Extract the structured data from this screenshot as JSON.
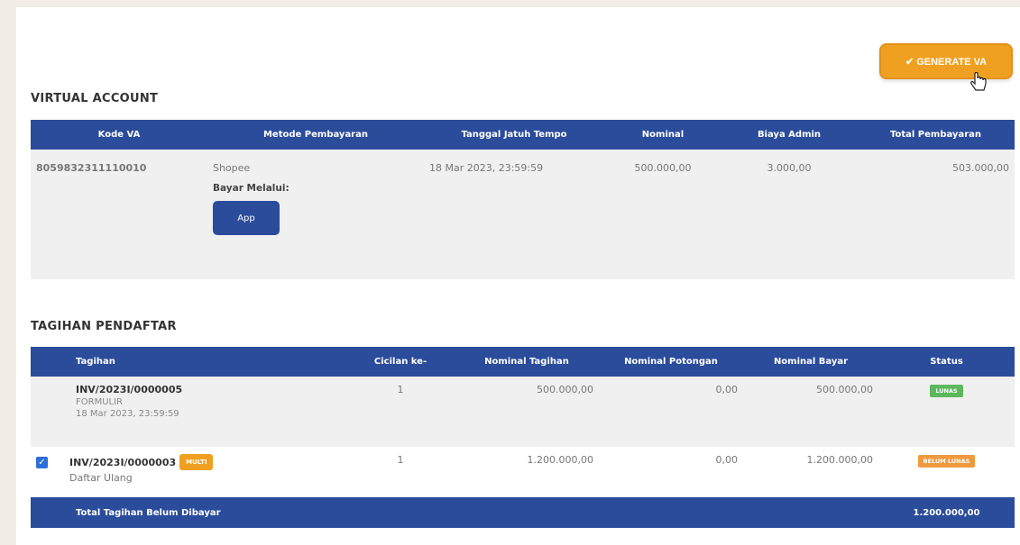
{
  "actions": {
    "generate_va_label": "✔ GENERATE VA"
  },
  "virtual_account": {
    "title": "VIRTUAL ACCOUNT",
    "columns": [
      "Kode VA",
      "Metode Pembayaran",
      "Tanggal Jatuh Tempo",
      "Nominal",
      "Biaya Admin",
      "Total Pembayaran"
    ],
    "row": {
      "kode_va": "8059832311110010",
      "metode": "Shopee",
      "bayar_melalui_label": "Bayar Melalui:",
      "app_label": "App",
      "jatuh_tempo": "18 Mar 2023, 23:59:59",
      "nominal": "500.000,00",
      "biaya_admin": "3.000,00",
      "total": "503.000,00"
    }
  },
  "tagihan": {
    "title": "TAGIHAN PENDAFTAR",
    "columns": [
      "Tagihan",
      "Cicilan ke-",
      "Nominal Tagihan",
      "Nominal Potongan",
      "Nominal Bayar",
      "Status"
    ],
    "rows": [
      {
        "invoice": "INV/2023I/0000005",
        "type": "FORMULIR",
        "date": "18 Mar 2023, 23:59:59",
        "cicilan": "1",
        "nominal_tagihan": "500.000,00",
        "nominal_potongan": "0,00",
        "nominal_bayar": "500.000,00",
        "status": "LUNAS"
      },
      {
        "checked": true,
        "invoice": "INV/2023I/0000003",
        "badge": "MULTI",
        "type": "Daftar Ulang",
        "cicilan": "1",
        "nominal_tagihan": "1.200.000,00",
        "nominal_potongan": "0,00",
        "nominal_bayar": "1.200.000,00",
        "status": "BELUM LUNAS"
      }
    ],
    "total_label": "Total Tagihan Belum Dibayar",
    "total_value": "1.200.000,00"
  },
  "colors": {
    "primary_blue": "#2b4c9b",
    "accent_orange": "#f0a020",
    "status_green": "#5cb85c",
    "status_orange": "#f09a40"
  }
}
